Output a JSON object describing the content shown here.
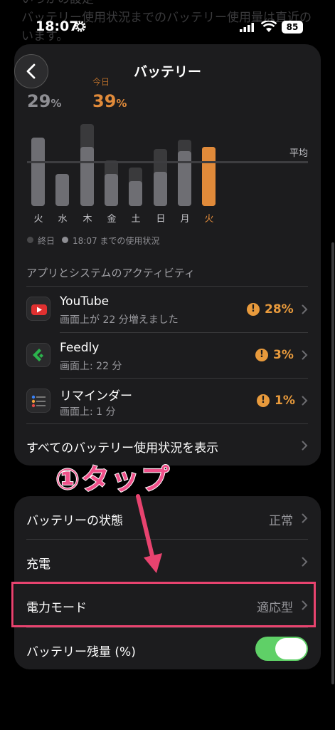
{
  "background_text": [
    "いっかの設定",
    "バッテリー使用状況までのバッテリー使用量は直近の",
    "います。"
  ],
  "status_bar": {
    "time": "18:07",
    "battery_level": "85"
  },
  "nav": {
    "title": "バッテリー"
  },
  "summary": {
    "today_label": "今日",
    "prev_pct": "29",
    "today_pct": "39",
    "pct_sign": "%"
  },
  "chart_data": {
    "type": "bar",
    "categories": [
      "火",
      "水",
      "木",
      "金",
      "土",
      "日",
      "月",
      "火"
    ],
    "series": [
      {
        "name": "終日",
        "values": [
          30,
          14,
          36,
          20,
          17,
          25,
          29,
          26
        ]
      },
      {
        "name": "18:07までの使用状況",
        "values": [
          30,
          14,
          26,
          14,
          11,
          15,
          24,
          26
        ]
      }
    ],
    "average_label": "平均",
    "highlight_index": 7,
    "highlight_color": "#e08a3a"
  },
  "legend": {
    "all_day": "終日",
    "until_now": "18:07 までの使用状況"
  },
  "section_header": "アプリとシステムのアクティビティ",
  "apps": [
    {
      "name": "YouTube",
      "subtitle": "画面上が 22 分増えました",
      "percent": "28%",
      "icon": "youtube-icon"
    },
    {
      "name": "Feedly",
      "subtitle": "画面上: 22 分",
      "percent": "3%",
      "icon": "feedly-icon"
    },
    {
      "name": "リマインダー",
      "subtitle": "画面上: 1 分",
      "percent": "1%",
      "icon": "reminders-icon"
    }
  ],
  "show_all": "すべてのバッテリー使用状況を表示",
  "annotation": "①タップ",
  "settings": [
    {
      "label": "バッテリーの状態",
      "value": "正常"
    },
    {
      "label": "充電",
      "value": ""
    },
    {
      "label": "電力モード",
      "value": "適応型"
    },
    {
      "label": "バッテリー残量 (%)",
      "value": ""
    }
  ],
  "colors": {
    "accent": "#e89a3c",
    "toggle_on": "#5fd067",
    "annotation": "#f0508a",
    "highlight": "#e8436f"
  }
}
